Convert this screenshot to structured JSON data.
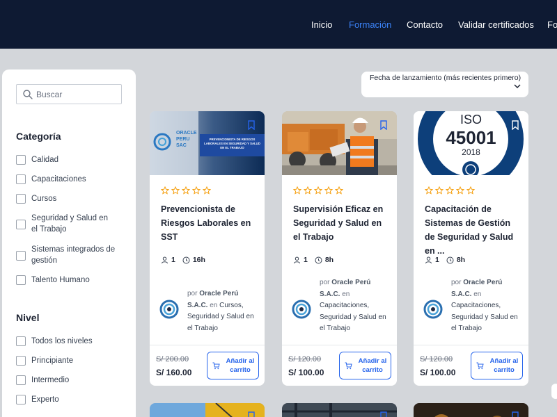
{
  "nav": {
    "items": [
      "Inicio",
      "Formación",
      "Contacto",
      "Validar certificados",
      "Fo"
    ],
    "active_index": 1,
    "colors": {
      "background": "#0e1a33",
      "active": "#3b82f6"
    }
  },
  "sidebar": {
    "search_placeholder": "Buscar",
    "category_title": "Categoría",
    "categories": [
      "Calidad",
      "Capacitaciones",
      "Cursos",
      "Seguridad y Salud en el Trabajo",
      "Sistemas integrados de gestión",
      "Talento Humano"
    ],
    "level_title": "Nivel",
    "levels": [
      "Todos los niveles",
      "Principiante",
      "Intermedio",
      "Experto"
    ]
  },
  "sort": {
    "selected": "Fecha de lanzamiento (más recientes primero)"
  },
  "courses": [
    {
      "title": "Prevencionista de Riesgos Laborales en SST",
      "rating": 0,
      "students": "1",
      "duration": "16h",
      "author_prefix": "por",
      "author": "Oracle Perú S.A.C.",
      "in_word": "en",
      "categories_text": "Cursos, Seguridad y Salud en el Trabajo",
      "price_old": "S/ 200.00",
      "price_new": "S/ 160.00",
      "cart_label": "Añadir al carrito",
      "banner": {
        "brand_line1": "ORACLE",
        "brand_line2": "PERU",
        "brand_line3": "SAC",
        "text": "PREVENCIONISTA DE RIESGOS LABORALES EN SEGURIDAD Y SALUD EN EL TRABAJO"
      }
    },
    {
      "title": "Supervisión Eficaz en Seguridad y Salud en el Trabajo",
      "rating": 0,
      "students": "1",
      "duration": "8h",
      "author_prefix": "por",
      "author": "Oracle Perú S.A.C.",
      "in_word": "en",
      "categories_text": "Capacitaciones, Seguridad y Salud en el Trabajo",
      "price_old": "S/ 120.00",
      "price_new": "S/ 100.00",
      "cart_label": "Añadir al carrito"
    },
    {
      "title": "Capacitación de Sistemas de Gestión de Seguridad y Salud en ...",
      "rating": 0,
      "students": "1",
      "duration": "8h",
      "author_prefix": "por",
      "author": "Oracle Perú S.A.C.",
      "in_word": "en",
      "categories_text": "Capacitaciones, Seguridad y Salud en el Trabajo",
      "price_old": "S/ 120.00",
      "price_new": "S/ 100.00",
      "cart_label": "Añadir al carrito",
      "badge": {
        "line1": "ISO",
        "line2": "45001",
        "line3": "2018"
      }
    }
  ],
  "colors": {
    "accent": "#2563eb",
    "star": "#f59e0b",
    "page_bg": "#d3d6da"
  }
}
